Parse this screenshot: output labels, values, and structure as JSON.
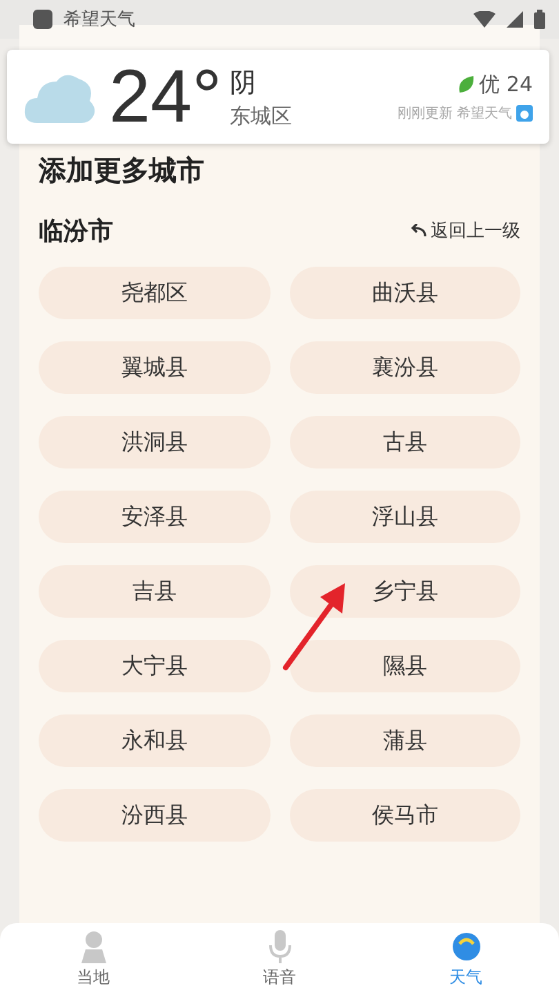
{
  "status_bar": {
    "app_name": "希望天气"
  },
  "weather_card": {
    "temperature": "24°",
    "condition": "阴",
    "district": "东城区",
    "air_quality": "优 24",
    "update_note": "刚刚更新 希望天气"
  },
  "add_city": {
    "title": "添加更多城市",
    "city": "临汾市",
    "back_link": "返回上一级",
    "districts": [
      "尧都区",
      "曲沃县",
      "翼城县",
      "襄汾县",
      "洪洞县",
      "古县",
      "安泽县",
      "浮山县",
      "吉县",
      "乡宁县",
      "大宁县",
      "隰县",
      "永和县",
      "蒲县",
      "汾西县",
      "侯马市"
    ]
  },
  "bottom_nav": [
    {
      "label": "当地",
      "kind": "local",
      "selected": false
    },
    {
      "label": "语音",
      "kind": "voice",
      "selected": false
    },
    {
      "label": "天气",
      "kind": "weather",
      "selected": true
    }
  ]
}
